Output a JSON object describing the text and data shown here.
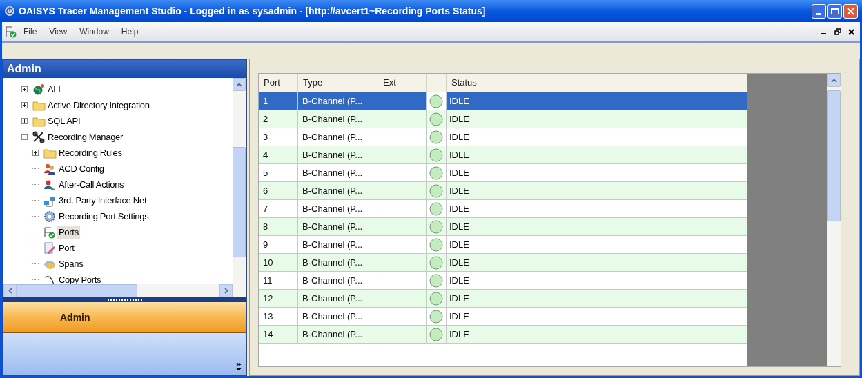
{
  "window": {
    "title": "OAISYS Tracer Management Studio - Logged in as sysadmin - [http://avcert1~Recording Ports Status]"
  },
  "menu": [
    "File",
    "View",
    "Window",
    "Help"
  ],
  "sidebar": {
    "title": "Admin",
    "tree": [
      {
        "label": "ALI",
        "kind": "globe",
        "expanded": false,
        "selected": false
      },
      {
        "label": "Active Directory Integration",
        "kind": "folder",
        "expanded": false,
        "selected": false
      },
      {
        "label": "SQL API",
        "kind": "folder",
        "expanded": false,
        "selected": false
      },
      {
        "label": "Recording Manager",
        "kind": "tools",
        "expanded": true,
        "selected": false,
        "children": [
          {
            "label": "Recording Rules",
            "kind": "folder",
            "expanded": false,
            "selected": false
          },
          {
            "label": "ACD Config",
            "kind": "people",
            "selected": false
          },
          {
            "label": "After-Call Actions",
            "kind": "person",
            "selected": false
          },
          {
            "label": "3rd. Party Interface Net",
            "kind": "network",
            "selected": false
          },
          {
            "label": "Recording Port Settings",
            "kind": "gear",
            "selected": false
          },
          {
            "label": "Ports",
            "kind": "check",
            "selected": true
          },
          {
            "label": "Port",
            "kind": "edit",
            "selected": false
          },
          {
            "label": "Spans",
            "kind": "spans",
            "selected": false
          },
          {
            "label": "Copy Ports",
            "kind": "copy",
            "selected": false
          }
        ]
      }
    ],
    "nav_button": "Admin"
  },
  "table": {
    "columns": [
      "Port",
      "Type",
      "Ext",
      "",
      "Status"
    ],
    "rows": [
      {
        "port": "1",
        "type": "B-Channel (P...",
        "status": "IDLE",
        "selected": true
      },
      {
        "port": "2",
        "type": "B-Channel (P...",
        "status": "IDLE",
        "selected": false
      },
      {
        "port": "3",
        "type": "B-Channel (P...",
        "status": "IDLE",
        "selected": false
      },
      {
        "port": "4",
        "type": "B-Channel (P...",
        "status": "IDLE",
        "selected": false
      },
      {
        "port": "5",
        "type": "B-Channel (P...",
        "status": "IDLE",
        "selected": false
      },
      {
        "port": "6",
        "type": "B-Channel (P...",
        "status": "IDLE",
        "selected": false
      },
      {
        "port": "7",
        "type": "B-Channel (P...",
        "status": "IDLE",
        "selected": false
      },
      {
        "port": "8",
        "type": "B-Channel (P...",
        "status": "IDLE",
        "selected": false
      },
      {
        "port": "9",
        "type": "B-Channel (P...",
        "status": "IDLE",
        "selected": false
      },
      {
        "port": "10",
        "type": "B-Channel (P...",
        "status": "IDLE",
        "selected": false
      },
      {
        "port": "11",
        "type": "B-Channel (P...",
        "status": "IDLE",
        "selected": false
      },
      {
        "port": "12",
        "type": "B-Channel (P...",
        "status": "IDLE",
        "selected": false
      },
      {
        "port": "13",
        "type": "B-Channel (P...",
        "status": "IDLE",
        "selected": false
      },
      {
        "port": "14",
        "type": "B-Channel (P...",
        "status": "IDLE",
        "selected": false
      }
    ]
  }
}
